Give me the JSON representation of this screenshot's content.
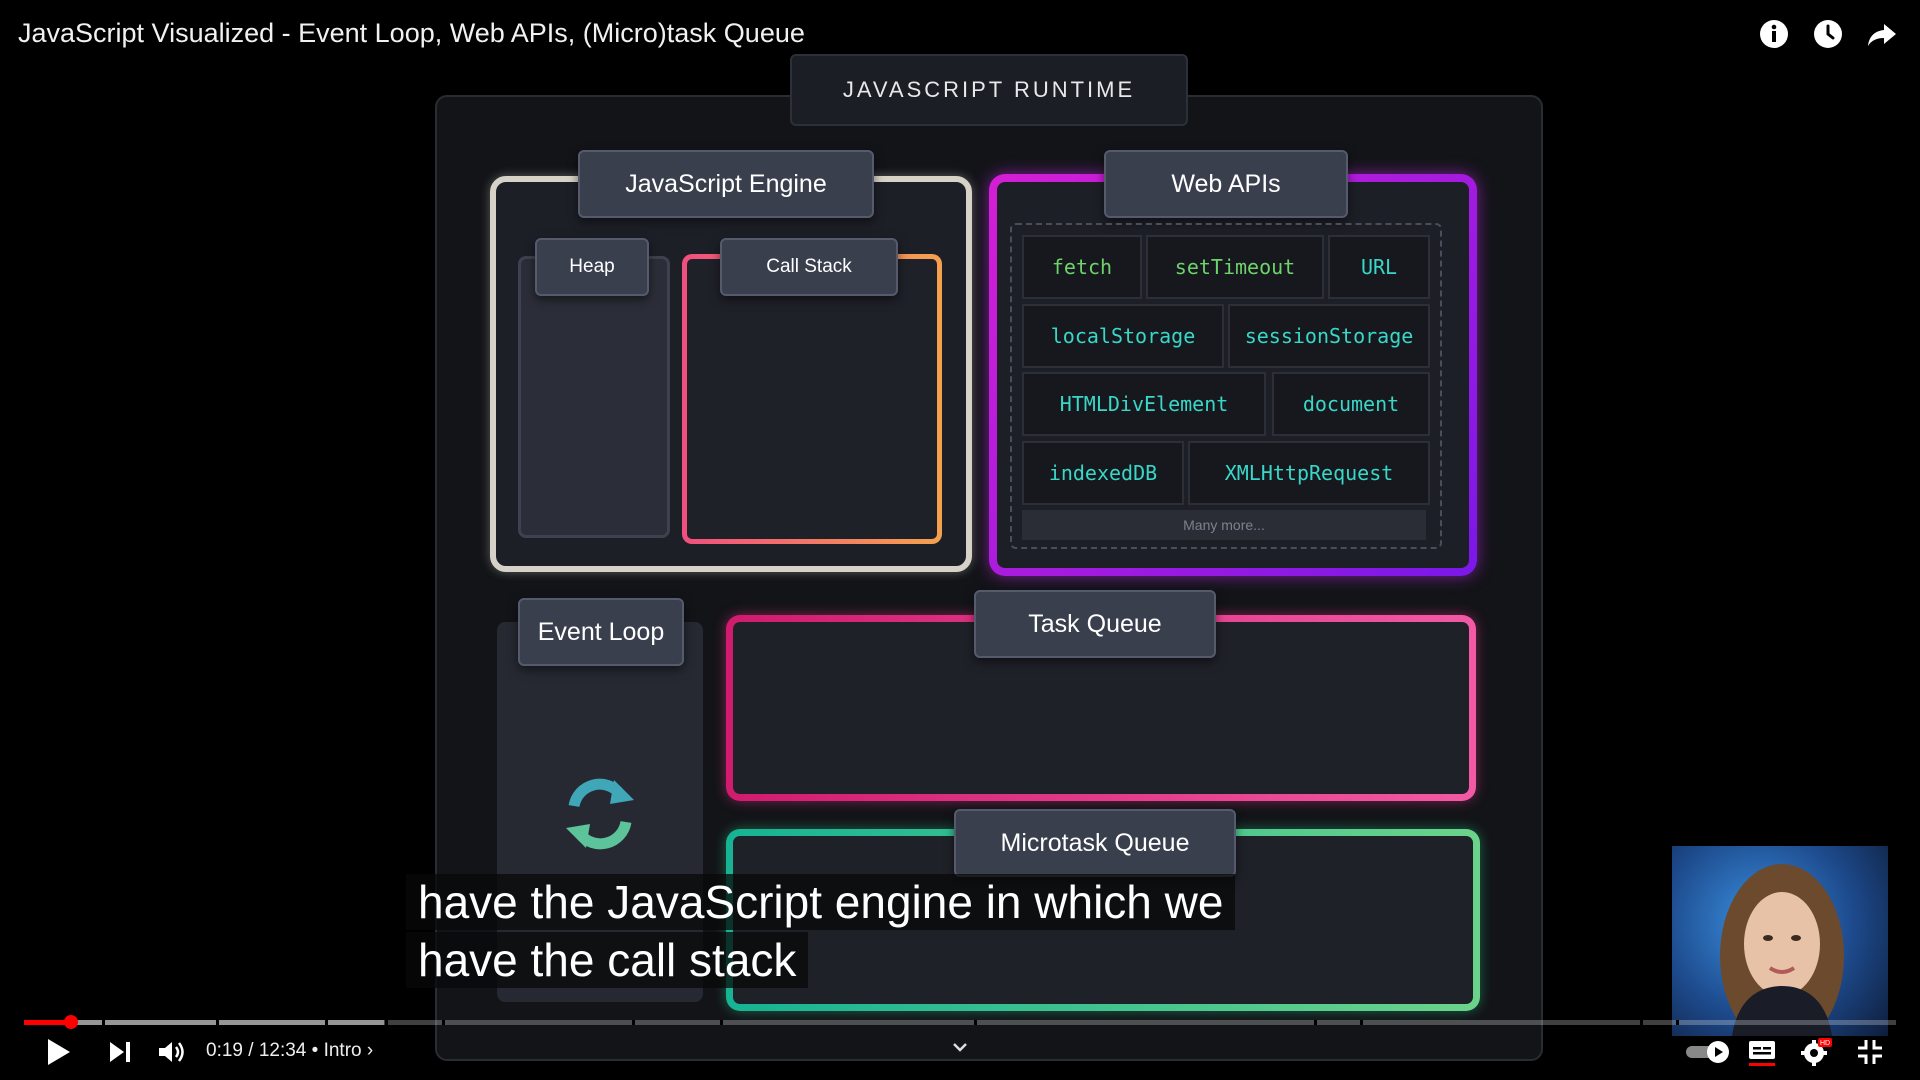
{
  "video": {
    "title": "JavaScript Visualized - Event Loop, Web APIs, (Micro)task Queue"
  },
  "top_icons": [
    "info-icon",
    "watch-later-icon",
    "share-icon"
  ],
  "diagram": {
    "runtime_label": "JAVASCRIPT RUNTIME",
    "engine_label": "JavaScript Engine",
    "heap_label": "Heap",
    "callstack_label": "Call Stack",
    "webapis_label": "Web APIs",
    "apis": {
      "fetch": "fetch",
      "setTimeout": "setTimeout",
      "url": "URL",
      "localStorage": "localStorage",
      "sessionStorage": "sessionStorage",
      "htmlDivElement": "HTMLDivElement",
      "document": "document",
      "indexedDB": "indexedDB",
      "xmlHttpRequest": "XMLHttpRequest"
    },
    "many_more": "Many more...",
    "eventloop_label": "Event Loop",
    "taskqueue_label": "Task Queue",
    "microtaskqueue_label": "Microtask Queue"
  },
  "captions": {
    "line1": "have the JavaScript engine in which we",
    "line2": "have the call stack"
  },
  "player": {
    "time": "0:19 / 12:34",
    "chapter": "• Intro",
    "progress_fraction": 0.025,
    "accent": "#ff0000"
  },
  "colors": {
    "webapi_green": "#6ed36b",
    "webapi_teal": "#39d7c8",
    "callstack": "#f14f7f",
    "taskqueue": "#e0338c",
    "microtaskqueue": "#2ec28f"
  }
}
